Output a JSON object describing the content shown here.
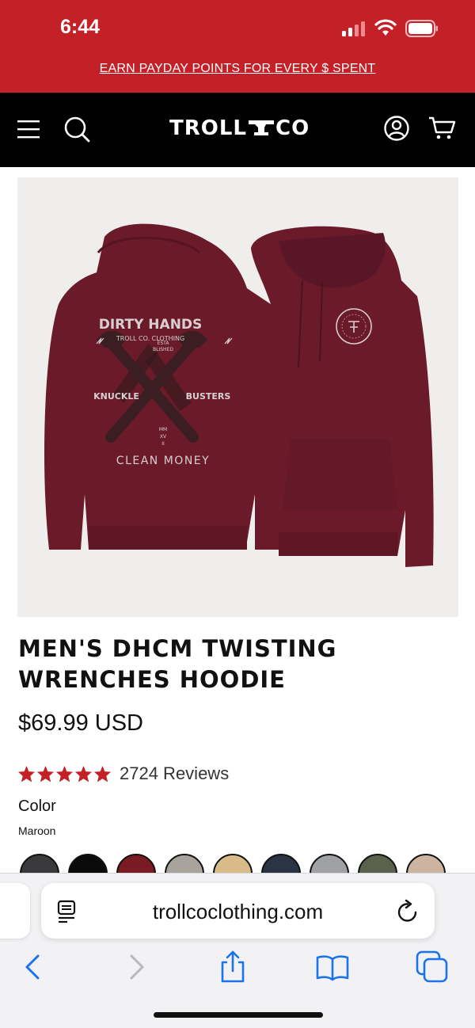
{
  "status_bar": {
    "time": "6:44"
  },
  "promo": {
    "text": "EARN PAYDAY POINTS FOR EVERY $ SPENT"
  },
  "header": {
    "logo_left": "TROLL",
    "logo_right": "CO"
  },
  "product": {
    "title": "MEN'S DHCM TWISTING WRENCHES HOODIE",
    "price": "$69.99 USD",
    "rating": 5,
    "review_count": "2724 Reviews",
    "color_label": "Color",
    "selected_color": "Maroon",
    "image_text": {
      "arc_top": "DIRTY HANDS",
      "arc_sub": "TROLL CO. CLOTHING",
      "est": "ESTA",
      "blished": "BLISHED",
      "left": "KNUCKLE",
      "right": "BUSTERS",
      "year1": "MM",
      "year2": "XV",
      "year3": "II",
      "bottom": "CLEAN MONEY",
      "chest": "DIRTY HANDS · CLEAN MONEY"
    },
    "swatch_colors": [
      "#3a3a3c",
      "#0b0b0b",
      "#7a1a22",
      "#a9a39d",
      "#d9bb8a",
      "#2a3445",
      "#9fa1a4",
      "#5b624c",
      "#cdb4a0"
    ]
  },
  "browser": {
    "url": "trollcoclothing.com"
  },
  "colors": {
    "brand_red": "#c42027",
    "maroon": "#6b1a2a",
    "star_red": "#c42027",
    "ios_blue": "#1a73e8"
  }
}
